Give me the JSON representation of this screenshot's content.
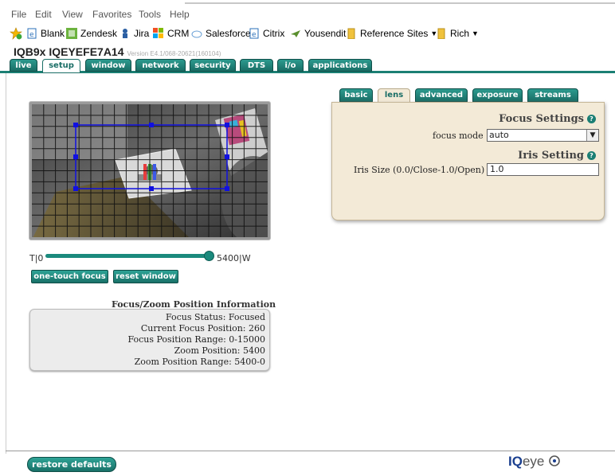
{
  "browser": {
    "menu": [
      "File",
      "Edit",
      "View",
      "Favorites",
      "Tools",
      "Help"
    ],
    "favorites": [
      {
        "label": "Blank",
        "icon": "ie-page-icon",
        "dropdown": false
      },
      {
        "label": "Zendesk",
        "icon": "zendesk-icon",
        "dropdown": false
      },
      {
        "label": "Jira",
        "icon": "jira-icon",
        "dropdown": false
      },
      {
        "label": "CRM",
        "icon": "windows-tiles-icon",
        "dropdown": false
      },
      {
        "label": "Salesforce",
        "icon": "cloud-icon",
        "dropdown": false
      },
      {
        "label": "Citrix",
        "icon": "ie-page-icon",
        "dropdown": false
      },
      {
        "label": "Yousendit",
        "icon": "paper-plane-icon",
        "dropdown": false
      },
      {
        "label": "Reference Sites",
        "icon": "folder-icon",
        "dropdown": true
      },
      {
        "label": "Rich",
        "icon": "folder-icon",
        "dropdown": true
      }
    ]
  },
  "device": {
    "title": "IQB9x IQEYEFE7A14",
    "version": "Version E4.1/068-20621(160104)"
  },
  "nav": {
    "tabs": [
      "live",
      "setup",
      "window",
      "network",
      "security",
      "DTS",
      "i/o",
      "applications"
    ],
    "active": "setup"
  },
  "slider": {
    "min_label": "T|0",
    "max_label": "5400|W",
    "value": 5400,
    "min": 0,
    "max": 5400
  },
  "buttons": {
    "one_touch": "one-touch focus",
    "reset_window": "reset window",
    "restore": "restore defaults"
  },
  "focus_info": {
    "title": "Focus/Zoom Position Information",
    "lines": [
      "Focus Status: Focused",
      "Current Focus Position: 260",
      "Focus Position Range: 0-15000",
      "Zoom Position: 5400",
      "Zoom Position Range: 5400-0"
    ]
  },
  "lens_panel": {
    "tabs": [
      "basic",
      "lens",
      "advanced",
      "exposure",
      "streams"
    ],
    "active": "lens",
    "focus_heading": "Focus Settings",
    "focus_mode_label": "focus mode",
    "focus_mode_value": "auto",
    "iris_heading": "Iris Setting",
    "iris_label": "Iris Size (0.0/Close-1.0/Open)",
    "iris_value": "1.0"
  },
  "footer": {
    "logo_iq": "IQ",
    "logo_rest": "eye"
  },
  "colors": {
    "teal": "#1b7f74",
    "panel_bg": "#f3ead7",
    "roi": "#1010e0"
  }
}
